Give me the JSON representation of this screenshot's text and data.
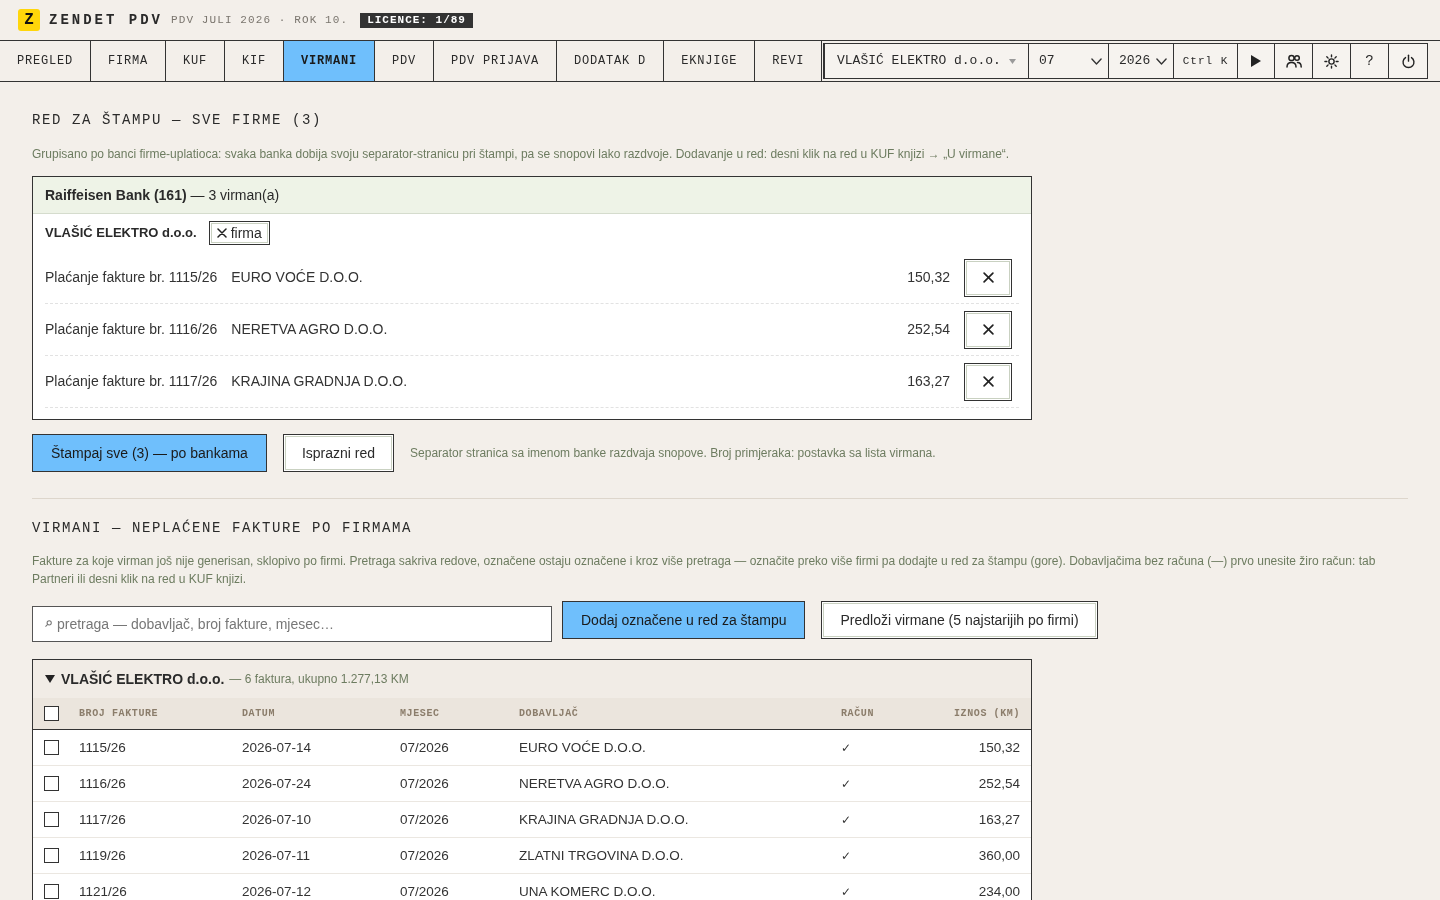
{
  "header": {
    "logo_letter": "Z",
    "app_name": "ZENDET PDV",
    "period": "PDV JULI 2026 · ROK 10.",
    "licence": "LICENCE: 1/89"
  },
  "tabs": [
    {
      "label": "PREGLED",
      "selected": false
    },
    {
      "label": "FIRMA",
      "selected": false
    },
    {
      "label": "KUF",
      "selected": false
    },
    {
      "label": "KIF",
      "selected": false
    },
    {
      "label": "VIRMANI",
      "selected": true
    },
    {
      "label": "PDV",
      "selected": false
    },
    {
      "label": "PDV PRIJAVA",
      "selected": false
    },
    {
      "label": "DODATAK D",
      "selected": false
    },
    {
      "label": "EKNJIGE",
      "selected": false
    },
    {
      "label": "REVI",
      "selected": false
    }
  ],
  "toolbar": {
    "company": "VLAŠIĆ ELEKTRO d.o.o.",
    "month": "07",
    "year": "2026",
    "shortcut": "Ctrl K",
    "help": "?"
  },
  "print_queue": {
    "title": "RED ZA ŠTAMPU — SVE FIRME (3)",
    "description": "Grupisano po banci firme-uplatioca: svaka banka dobija svoju separator-stranicu pri štampi, pa se snopovi lako razdvoje. Dodavanje u red: desni klik na red u KUF knjizi → „U virmane“.",
    "banks": [
      {
        "title": "**Raiffeisen Bank (161)** — 3 virman(a)",
        "firms": [
          {
            "name": "VLAŠIĆ ELEKTRO d.o.o.",
            "remove_label": "firma",
            "items": [
              {
                "description": "Plaćanje fakture br. 1115/26",
                "payee": "EURO VOĆE D.O.O.",
                "amount": "150,32"
              },
              {
                "description": "Plaćanje fakture br. 1116/26",
                "payee": "NERETVA AGRO D.O.O.",
                "amount": "252,54"
              },
              {
                "description": "Plaćanje fakture br. 1117/26",
                "payee": "KRAJINA GRADNJA D.O.O.",
                "amount": "163,27"
              }
            ]
          }
        ]
      }
    ],
    "print_button": "Štampaj sve (3) — po bankama",
    "clear_button": "Isprazni red",
    "note": "Separator stranica sa imenom banke razdvaja snopove. Broj primjeraka: postavka sa lista virmana."
  },
  "unpaid": {
    "title": "VIRMANI — NEPLAĆENE FAKTURE PO FIRMAMA",
    "description": "Fakture za koje virman još nije generisan, sklopivo po firmi. Pretraga sakriva redove, označene ostaju označene i kroz više pretraga — označite preko više firmi pa dodajte u red za štampu (gore). Dobavljačima bez računa (—) prvo unesite žiro račun: tab Partneri ili desni klik na red u KUF knjizi.",
    "search": {
      "placeholder": "pretraga — dobavljač, broj fakture, mjesec…"
    },
    "add_button": "Dodaj označene u red za štampu",
    "suggest_button": "Predloži virmane (5 najstarijih po firmi)",
    "groups": [
      {
        "company": "VLAŠIĆ ELEKTRO d.o.o.",
        "summary": "— 6 faktura, ukupno 1.277,13 KM",
        "expanded": true,
        "all_checked": false,
        "columns": [
          "BROJ FAKTURE",
          "DATUM",
          "MJESEC",
          "DOBAVLJAČ",
          "RAČUN",
          "IZNOS (KM)"
        ],
        "rows": [
          {
            "number": "1115/26",
            "date": "2026-07-14",
            "month": "07/2026",
            "supplier": "EURO VOĆE D.O.O.",
            "account": "✓",
            "amount": "150,32",
            "checked": false
          },
          {
            "number": "1116/26",
            "date": "2026-07-24",
            "month": "07/2026",
            "supplier": "NERETVA AGRO D.O.O.",
            "account": "✓",
            "amount": "252,54",
            "checked": false
          },
          {
            "number": "1117/26",
            "date": "2026-07-10",
            "month": "07/2026",
            "supplier": "KRAJINA GRADNJA D.O.O.",
            "account": "✓",
            "amount": "163,27",
            "checked": false
          },
          {
            "number": "1119/26",
            "date": "2026-07-11",
            "month": "07/2026",
            "supplier": "ZLATNI TRGOVINA D.O.O.",
            "account": "✓",
            "amount": "360,00",
            "checked": false
          },
          {
            "number": "1121/26",
            "date": "2026-07-12",
            "month": "07/2026",
            "supplier": "UNA KOMERC D.O.O.",
            "account": "✓",
            "amount": "234,00",
            "checked": false
          }
        ]
      }
    ]
  }
}
